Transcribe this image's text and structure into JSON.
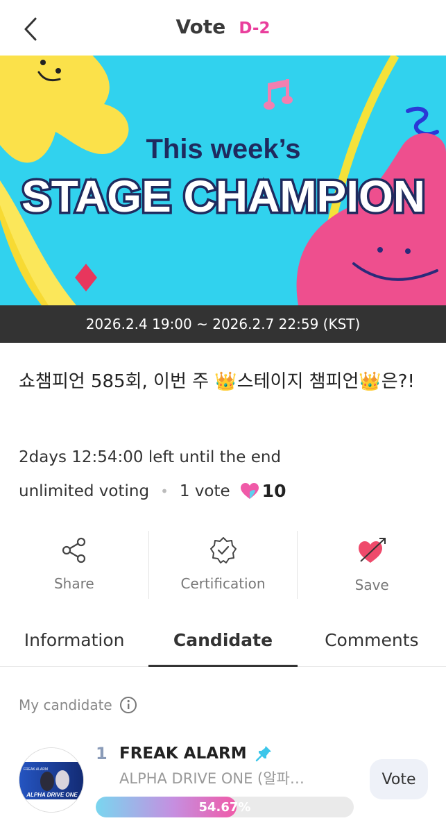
{
  "header": {
    "title": "Vote",
    "dday": "D-2",
    "back_icon": "chevron-left-icon"
  },
  "banner": {
    "line1": "This week’s",
    "line2": "STAGE CHAMPION",
    "period": "2026.2.4 19:00 ~ 2026.2.7 22:59 (KST)"
  },
  "vote": {
    "title": "쇼챔피언 585회, 이번 주 👑스테이지 챔피언👑은?!",
    "remaining": "2days 12:54:00 left until the end",
    "voting_type": "unlimited voting",
    "per_vote": "1 vote",
    "heart_count": "10"
  },
  "actions": {
    "share": "Share",
    "certification": "Certification",
    "save": "Save"
  },
  "tabs": [
    "Information",
    "Candidate",
    "Comments"
  ],
  "active_tab": "Candidate",
  "candidates_section": {
    "label": "My candidate"
  },
  "candidate": {
    "rank": "1",
    "name": "FREAK ALARM",
    "artist": "ALPHA DRIVE ONE (알파…",
    "percent_text": "54.67%",
    "percent": 54.67,
    "vote_label": "Vote",
    "thumb_text_small": "FREAK ALARM",
    "thumb_text": "ALPHA DRIVE ONE"
  },
  "colors": {
    "accent": "#e93e9c",
    "banner_bg": "#31d2ee",
    "period_bar": "#333333"
  }
}
